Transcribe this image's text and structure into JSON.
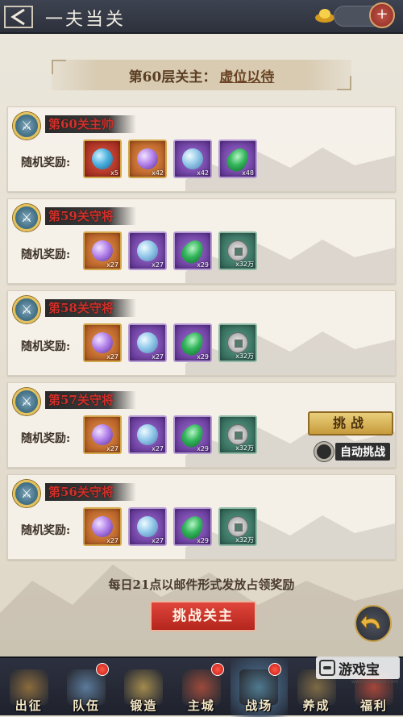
{
  "header": {
    "title": "一夫当关",
    "back_icon": "back-arrow-icon",
    "currency_icon": "gold-ingot-icon",
    "add_icon": "plus-icon"
  },
  "boss_banner": {
    "prefix": "第60层关主：",
    "name": "虚位以待"
  },
  "reward_label": "随机奖励:",
  "guards": [
    {
      "title": "第60关主帅",
      "items": [
        {
          "kind": "orb-blue",
          "frame": "red",
          "qty": "x5"
        },
        {
          "kind": "orb-violet",
          "frame": "orange",
          "qty": "x42"
        },
        {
          "kind": "orb-lightblue",
          "frame": "purple",
          "qty": "x42"
        },
        {
          "kind": "leaf",
          "frame": "purple",
          "qty": "x48"
        }
      ]
    },
    {
      "title": "第59关守将",
      "items": [
        {
          "kind": "orb-violet",
          "frame": "orange",
          "qty": "x27"
        },
        {
          "kind": "orb-lightblue",
          "frame": "purple",
          "qty": "x27"
        },
        {
          "kind": "leaf",
          "frame": "purple",
          "qty": "x29"
        },
        {
          "kind": "coin",
          "frame": "green",
          "qty": "x32万"
        }
      ]
    },
    {
      "title": "第58关守将",
      "items": [
        {
          "kind": "orb-violet",
          "frame": "orange",
          "qty": "x27"
        },
        {
          "kind": "orb-lightblue",
          "frame": "purple",
          "qty": "x27"
        },
        {
          "kind": "leaf",
          "frame": "purple",
          "qty": "x29"
        },
        {
          "kind": "coin",
          "frame": "green",
          "qty": "x32万"
        }
      ]
    },
    {
      "title": "第57关守将",
      "items": [
        {
          "kind": "orb-violet",
          "frame": "orange",
          "qty": "x27"
        },
        {
          "kind": "orb-lightblue",
          "frame": "purple",
          "qty": "x27"
        },
        {
          "kind": "leaf",
          "frame": "purple",
          "qty": "x29"
        },
        {
          "kind": "coin",
          "frame": "green",
          "qty": "x32万"
        }
      ]
    },
    {
      "title": "第56关守将",
      "items": [
        {
          "kind": "orb-violet",
          "frame": "orange",
          "qty": "x27"
        },
        {
          "kind": "orb-lightblue",
          "frame": "purple",
          "qty": "x27"
        },
        {
          "kind": "leaf",
          "frame": "purple",
          "qty": "x29"
        },
        {
          "kind": "coin",
          "frame": "green",
          "qty": "x32万"
        }
      ]
    }
  ],
  "challenge_button": "挑战",
  "auto_challenge_label": "自动挑战",
  "notice": "每日21点以邮件形式发放占领奖励",
  "boss_challenge_button": "挑战关主",
  "return_icon": "return-arrow-icon",
  "nav": [
    {
      "label": "出征",
      "icon": "crossed-swords-icon",
      "badge": false,
      "active": false
    },
    {
      "label": "队伍",
      "icon": "warrior-icon",
      "badge": true,
      "active": false
    },
    {
      "label": "锻造",
      "icon": "anvil-icon",
      "badge": false,
      "active": false
    },
    {
      "label": "主城",
      "icon": "palace-icon",
      "badge": true,
      "active": false
    },
    {
      "label": "战场",
      "icon": "battlefield-icon",
      "badge": true,
      "active": true
    },
    {
      "label": "养成",
      "icon": "helmet-icon",
      "badge": false,
      "active": false
    },
    {
      "label": "福利",
      "icon": "gift-icon",
      "badge": false,
      "active": false
    }
  ],
  "watermark": {
    "text": "游戏宝",
    "url": "www.youxibao.com"
  },
  "colors": {
    "header_bg": "#2d313c",
    "guard_title": "#d2312b",
    "boss_button": "#c9322a",
    "challenge_button": "#d8b555",
    "nav_bg": "#23262f"
  }
}
